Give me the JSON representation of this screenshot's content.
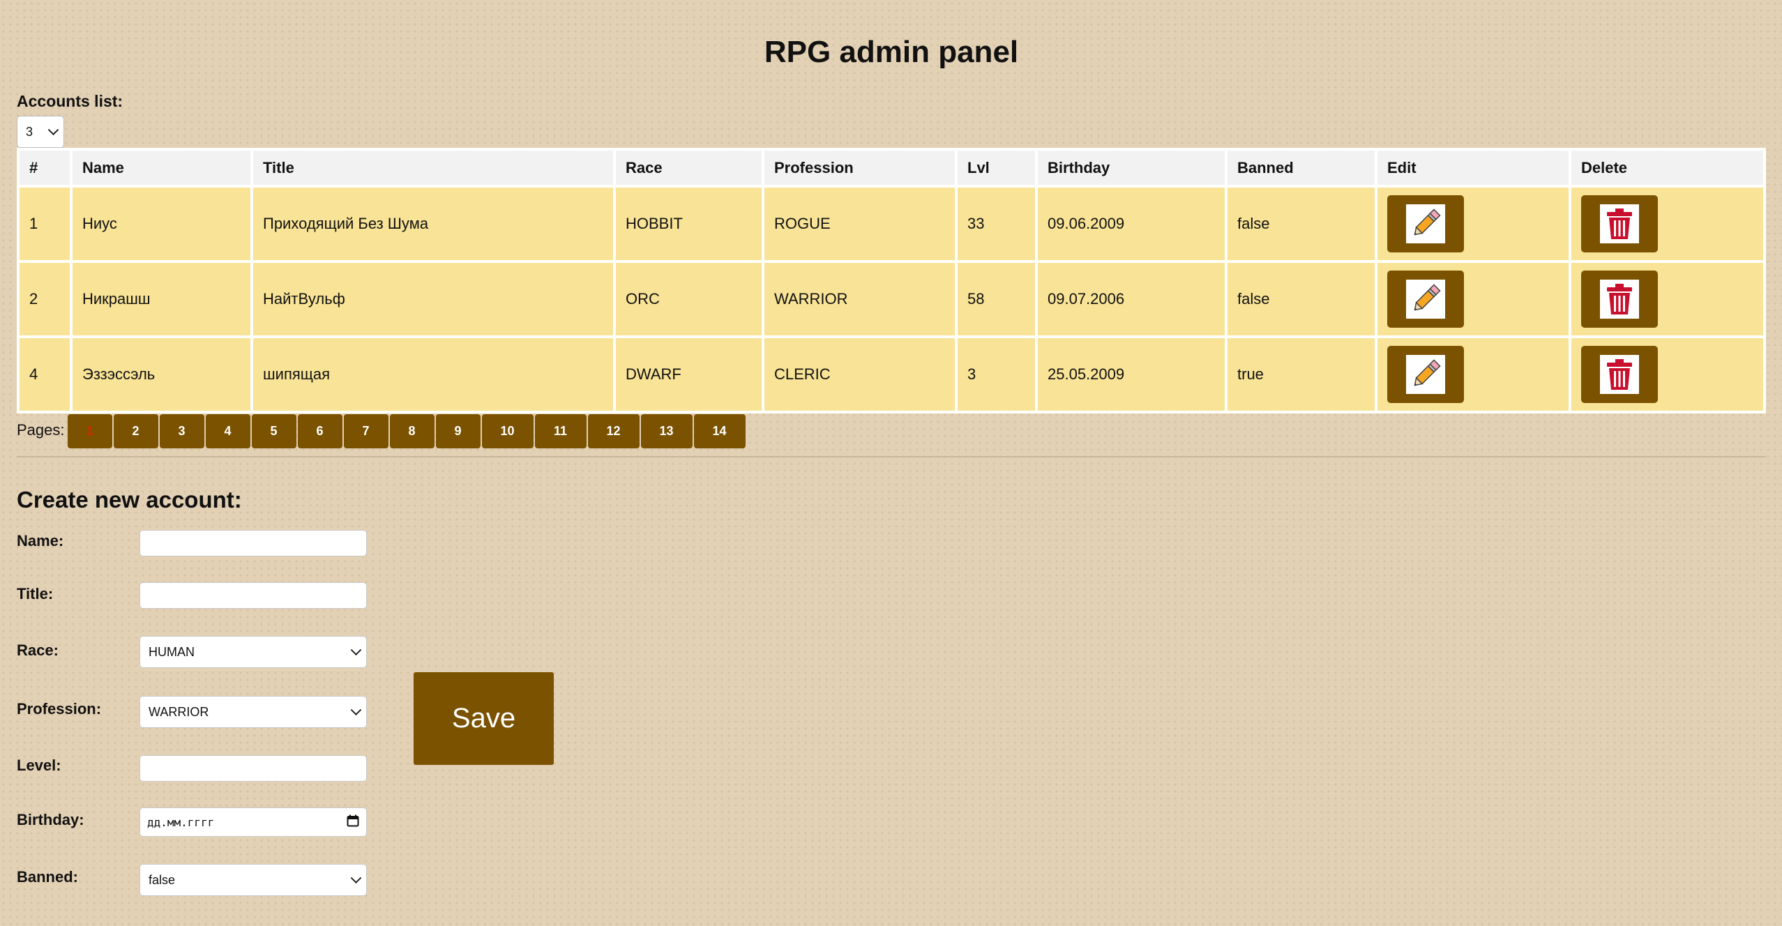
{
  "header": {
    "title": "RPG admin panel"
  },
  "accounts": {
    "label": "Accounts list:",
    "page_size": "3",
    "columns": [
      "#",
      "Name",
      "Title",
      "Race",
      "Profession",
      "Lvl",
      "Birthday",
      "Banned",
      "Edit",
      "Delete"
    ],
    "rows": [
      {
        "id": "1",
        "name": "Ниус",
        "title": "Приходящий Без Шума",
        "race": "HOBBIT",
        "profession": "ROGUE",
        "level": "33",
        "birthday": "09.06.2009",
        "banned": "false"
      },
      {
        "id": "2",
        "name": "Никрашш",
        "title": "НайтВульф",
        "race": "ORC",
        "profession": "WARRIOR",
        "level": "58",
        "birthday": "09.07.2006",
        "banned": "false"
      },
      {
        "id": "4",
        "name": "Эззэссэль",
        "title": "шипящая",
        "race": "DWARF",
        "profession": "CLERIC",
        "level": "3",
        "birthday": "25.05.2009",
        "banned": "true"
      }
    ],
    "edit_icon": "pencil-icon",
    "delete_icon": "trash-icon"
  },
  "pagination": {
    "label": "Pages:",
    "current": "1",
    "pages": [
      "1",
      "2",
      "3",
      "4",
      "5",
      "6",
      "7",
      "8",
      "9",
      "10",
      "11",
      "12",
      "13",
      "14"
    ]
  },
  "create_form": {
    "heading": "Create new account:",
    "name_label": "Name:",
    "title_label": "Title:",
    "race_label": "Race:",
    "race_value": "HUMAN",
    "profession_label": "Profession:",
    "profession_value": "WARRIOR",
    "level_label": "Level:",
    "birthday_label": "Birthday:",
    "birthday_placeholder": "дд.мм.гггг",
    "banned_label": "Banned:",
    "banned_value": "false",
    "save_label": "Save"
  },
  "colors": {
    "background": "#e3d1b5",
    "row": "#f8e396",
    "button": "#7a5200",
    "active_page": "#d52b00",
    "delete_icon": "#c8102e"
  }
}
